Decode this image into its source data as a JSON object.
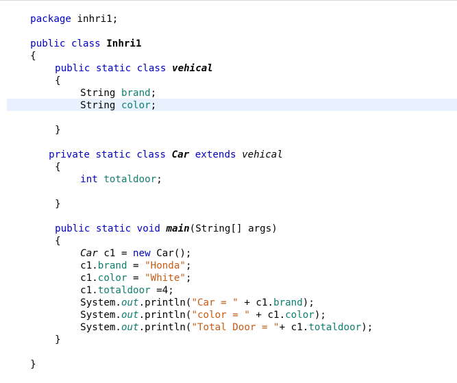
{
  "editor": {
    "lines": {
      "l1": {
        "a": "package",
        "b": " inhri1;"
      },
      "l3": {
        "a": "public",
        "b": " ",
        "c": "class",
        "d": " ",
        "e": "Inhri1"
      },
      "l4": {
        "a": "{"
      },
      "l5": {
        "a": "public",
        "b": " ",
        "c": "static",
        "d": " ",
        "e": "class",
        "f": " ",
        "g": "vehical"
      },
      "l6": {
        "a": "{"
      },
      "l7": {
        "a": "String ",
        "b": "brand",
        "c": ";"
      },
      "l8": {
        "a": "String ",
        "b": "color",
        "c": ";"
      },
      "l10": {
        "a": "}"
      },
      "l12": {
        "a": "private",
        "b": " ",
        "c": "static",
        "d": " ",
        "e": "class",
        "f": " ",
        "g": "Car",
        "h": " ",
        "i": "extends",
        "j": " ",
        "k": "vehical"
      },
      "l13": {
        "a": "{"
      },
      "l14": {
        "a": "int",
        "b": " ",
        "c": "totaldoor",
        "d": ";"
      },
      "l16": {
        "a": "}"
      },
      "l18": {
        "a": "public",
        "b": " ",
        "c": "static",
        "d": " ",
        "e": "void",
        "f": " ",
        "g": "main",
        "h": "(String[] args)"
      },
      "l19": {
        "a": "{"
      },
      "l20": {
        "a": "Car",
        "b": " c1 = ",
        "c": "new",
        "d": " Car();"
      },
      "l21": {
        "a": "c1.",
        "b": "brand",
        "c": " = ",
        "d": "\"Honda\"",
        "e": ";"
      },
      "l22": {
        "a": "c1.",
        "b": "color",
        "c": " = ",
        "d": "\"White\"",
        "e": ";"
      },
      "l23": {
        "a": "c1.",
        "b": "totaldoor",
        "c": " =4;"
      },
      "l24": {
        "a": "System.",
        "b": "out",
        "c": ".println(",
        "d": "\"Car = \"",
        "e": " + c1.",
        "f": "brand",
        "g": ");"
      },
      "l25": {
        "a": "System.",
        "b": "out",
        "c": ".println(",
        "d": "\"color = \"",
        "e": " + c1.",
        "f": "color",
        "g": ");"
      },
      "l26": {
        "a": "System.",
        "b": "out",
        "c": ".println(",
        "d": "\"Total Door = \"",
        "e": "+ c1.",
        "f": "totaldoor",
        "g": ");"
      },
      "l27": {
        "a": "}"
      },
      "l29": {
        "a": "}"
      }
    },
    "colors": {
      "keyword": "#0000c0",
      "field": "#0e7f6e",
      "string": "#c75b15",
      "current_line": "#e8f2fe"
    }
  }
}
